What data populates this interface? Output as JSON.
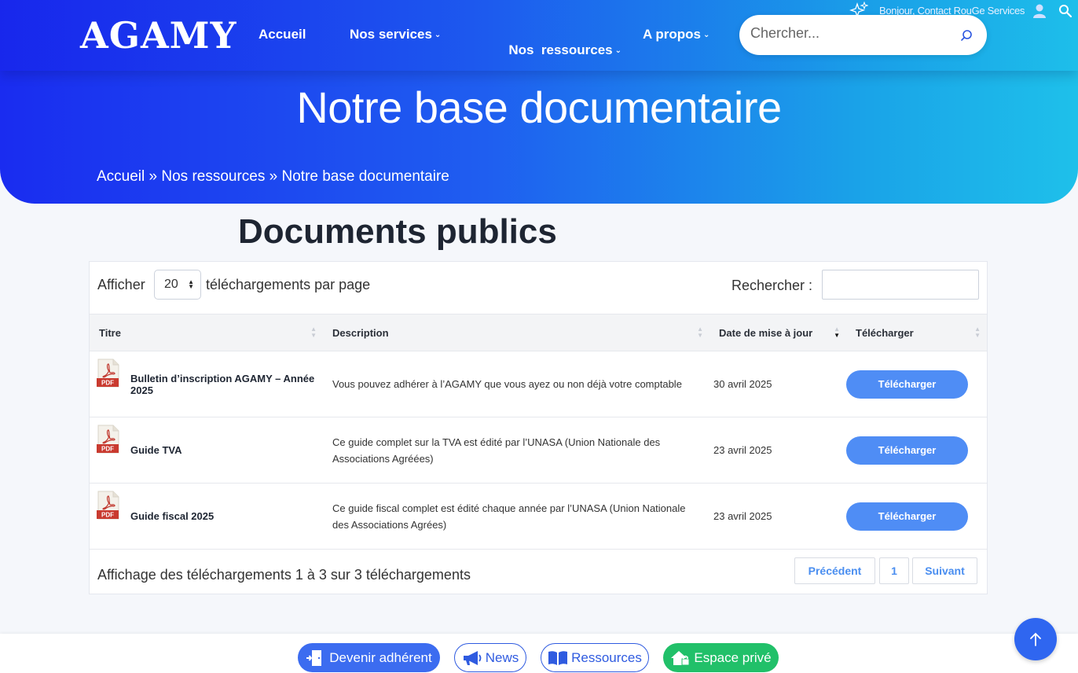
{
  "header": {
    "logo": "AGAMY",
    "nav": [
      {
        "label": "Accueil",
        "has_dropdown": false
      },
      {
        "label": "Nos services",
        "has_dropdown": true
      },
      {
        "label": "Nos  ressources",
        "has_dropdown": true
      },
      {
        "label": "A propos",
        "has_dropdown": true
      }
    ],
    "search_placeholder": "Chercher...",
    "topbar_text": "Bonjour, Contact RouGe Services"
  },
  "hero": {
    "title": "Notre base documentaire",
    "breadcrumb": {
      "home": "Accueil",
      "sep1": " » ",
      "section": "Nos ressources",
      "sep2": " » ",
      "current": "Notre base documentaire"
    }
  },
  "section": {
    "title": "Documents publics"
  },
  "table_controls": {
    "show_label": "Afficher",
    "per_page_value": "20",
    "per_page_label": "téléchargements par page",
    "filter_label": "Rechercher :"
  },
  "table": {
    "columns": [
      "Titre",
      "Description",
      "Date de mise à jour",
      "Télécharger"
    ],
    "sorted_column": "Date de mise à jour",
    "sort_direction": "desc",
    "rows": [
      {
        "title": "Bulletin d’inscription AGAMY – Année 2025",
        "description": "Vous pouvez adhérer à l’AGAMY que vous ayez ou non déjà votre comptable",
        "date": "30 avril 2025",
        "button": "Télécharger"
      },
      {
        "title": "Guide TVA",
        "description": "Ce guide complet sur la TVA est édité par l’UNASA (Union Nationale des Associations Agréées)",
        "date": "23 avril 2025",
        "button": "Télécharger"
      },
      {
        "title": "Guide fiscal 2025",
        "description": "Ce guide fiscal complet est édité chaque année par l’UNASA (Union Nationale des Associations Agrées)",
        "date": "23 avril 2025",
        "button": "Télécharger"
      }
    ],
    "pdf_badge": "PDF"
  },
  "pagination": {
    "info": "Affichage des téléchargements 1 à 3 sur 3 téléchargements",
    "previous": "Précédent",
    "current_page": "1",
    "next": "Suivant"
  },
  "bottom_bar": {
    "become_member": "Devenir adhérent",
    "news": "News",
    "resources": "Ressources",
    "private_space": "Espace privé"
  },
  "colors": {
    "hero_gradient_start": "#1a2cf0",
    "hero_gradient_end": "#1ec0ea",
    "button_blue": "#4f8df5",
    "green": "#21c069",
    "pager_text": "#4a8ef0"
  }
}
